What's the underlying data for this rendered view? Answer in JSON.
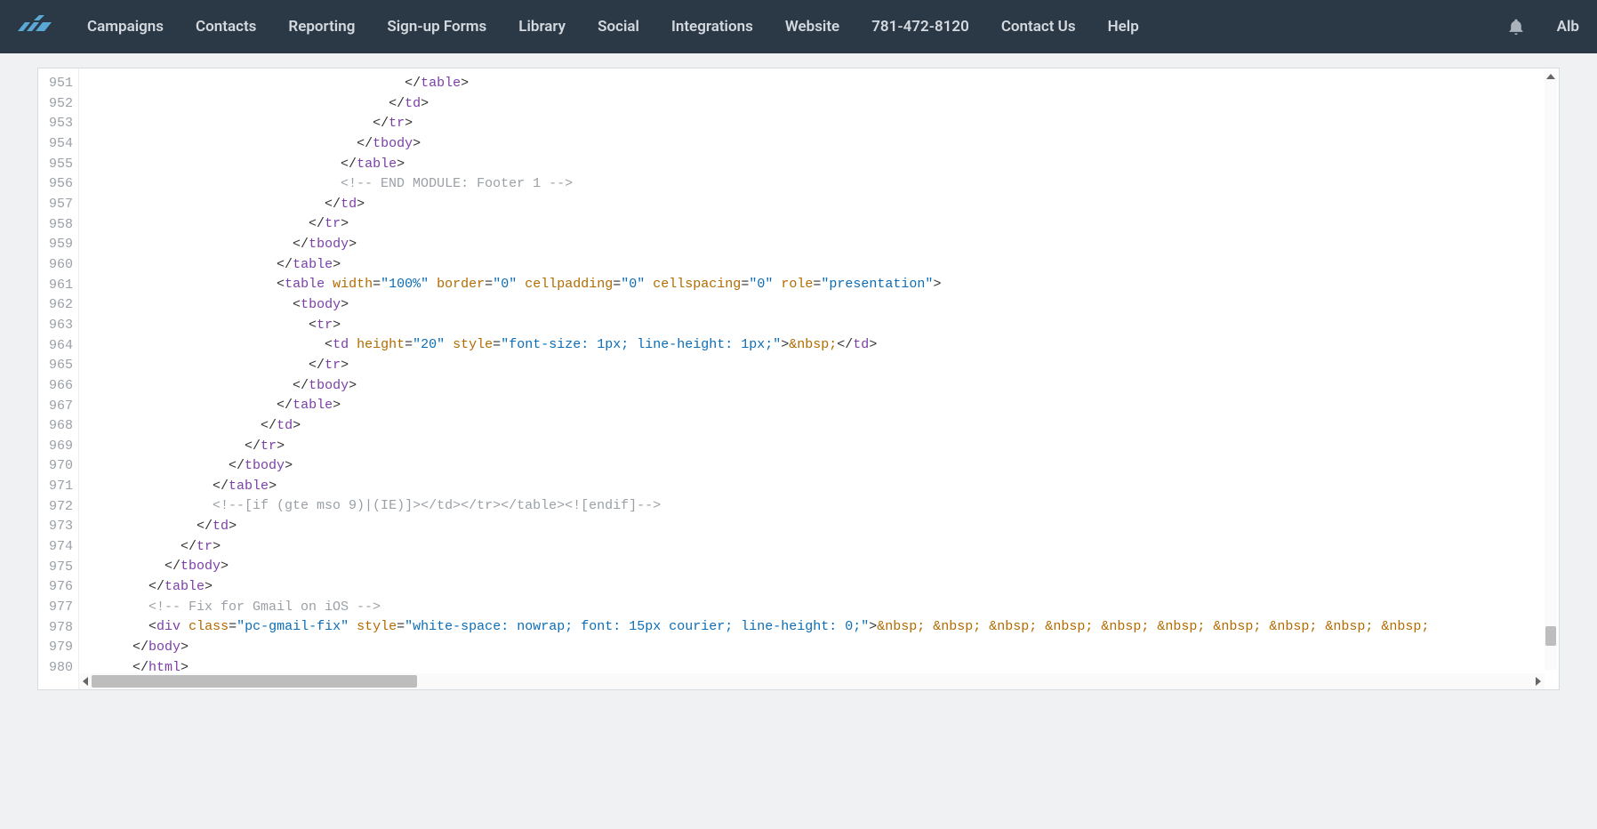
{
  "nav": {
    "items": [
      "Campaigns",
      "Contacts",
      "Reporting",
      "Sign-up Forms",
      "Library",
      "Social",
      "Integrations",
      "Website"
    ],
    "phone": "781-472-8120",
    "contact": "Contact Us",
    "help": "Help",
    "user": "Alb"
  },
  "gutter": {
    "start": 951,
    "count": 30
  },
  "code": [
    {
      "indent": 40,
      "tokens": [
        {
          "t": "punct",
          "v": "</"
        },
        {
          "t": "tag",
          "v": "table"
        },
        {
          "t": "punct",
          "v": ">"
        }
      ]
    },
    {
      "indent": 38,
      "tokens": [
        {
          "t": "punct",
          "v": "</"
        },
        {
          "t": "tag",
          "v": "td"
        },
        {
          "t": "punct",
          "v": ">"
        }
      ]
    },
    {
      "indent": 36,
      "tokens": [
        {
          "t": "punct",
          "v": "</"
        },
        {
          "t": "tag",
          "v": "tr"
        },
        {
          "t": "punct",
          "v": ">"
        }
      ]
    },
    {
      "indent": 34,
      "tokens": [
        {
          "t": "punct",
          "v": "</"
        },
        {
          "t": "tag",
          "v": "tbody"
        },
        {
          "t": "punct",
          "v": ">"
        }
      ]
    },
    {
      "indent": 32,
      "tokens": [
        {
          "t": "punct",
          "v": "</"
        },
        {
          "t": "tag",
          "v": "table"
        },
        {
          "t": "punct",
          "v": ">"
        }
      ]
    },
    {
      "indent": 32,
      "tokens": [
        {
          "t": "cmt",
          "v": "<!-- END MODULE: Footer 1 -->"
        }
      ]
    },
    {
      "indent": 30,
      "tokens": [
        {
          "t": "punct",
          "v": "</"
        },
        {
          "t": "tag",
          "v": "td"
        },
        {
          "t": "punct",
          "v": ">"
        }
      ]
    },
    {
      "indent": 28,
      "tokens": [
        {
          "t": "punct",
          "v": "</"
        },
        {
          "t": "tag",
          "v": "tr"
        },
        {
          "t": "punct",
          "v": ">"
        }
      ]
    },
    {
      "indent": 26,
      "tokens": [
        {
          "t": "punct",
          "v": "</"
        },
        {
          "t": "tag",
          "v": "tbody"
        },
        {
          "t": "punct",
          "v": ">"
        }
      ]
    },
    {
      "indent": 24,
      "tokens": [
        {
          "t": "punct",
          "v": "</"
        },
        {
          "t": "tag",
          "v": "table"
        },
        {
          "t": "punct",
          "v": ">"
        }
      ]
    },
    {
      "indent": 24,
      "tokens": [
        {
          "t": "punct",
          "v": "<"
        },
        {
          "t": "tag",
          "v": "table"
        },
        {
          "t": "punct",
          "v": " "
        },
        {
          "t": "attr",
          "v": "width"
        },
        {
          "t": "punct",
          "v": "="
        },
        {
          "t": "str",
          "v": "\"100%\""
        },
        {
          "t": "punct",
          "v": " "
        },
        {
          "t": "attr",
          "v": "border"
        },
        {
          "t": "punct",
          "v": "="
        },
        {
          "t": "str",
          "v": "\"0\""
        },
        {
          "t": "punct",
          "v": " "
        },
        {
          "t": "attr",
          "v": "cellpadding"
        },
        {
          "t": "punct",
          "v": "="
        },
        {
          "t": "str",
          "v": "\"0\""
        },
        {
          "t": "punct",
          "v": " "
        },
        {
          "t": "attr",
          "v": "cellspacing"
        },
        {
          "t": "punct",
          "v": "="
        },
        {
          "t": "str",
          "v": "\"0\""
        },
        {
          "t": "punct",
          "v": " "
        },
        {
          "t": "attr",
          "v": "role"
        },
        {
          "t": "punct",
          "v": "="
        },
        {
          "t": "str",
          "v": "\"presentation\""
        },
        {
          "t": "punct",
          "v": ">"
        }
      ]
    },
    {
      "indent": 26,
      "tokens": [
        {
          "t": "punct",
          "v": "<"
        },
        {
          "t": "tag",
          "v": "tbody"
        },
        {
          "t": "punct",
          "v": ">"
        }
      ]
    },
    {
      "indent": 28,
      "tokens": [
        {
          "t": "punct",
          "v": "<"
        },
        {
          "t": "tag",
          "v": "tr"
        },
        {
          "t": "punct",
          "v": ">"
        }
      ]
    },
    {
      "indent": 30,
      "tokens": [
        {
          "t": "punct",
          "v": "<"
        },
        {
          "t": "tag",
          "v": "td"
        },
        {
          "t": "punct",
          "v": " "
        },
        {
          "t": "attr",
          "v": "height"
        },
        {
          "t": "punct",
          "v": "="
        },
        {
          "t": "str",
          "v": "\"20\""
        },
        {
          "t": "punct",
          "v": " "
        },
        {
          "t": "attr",
          "v": "style"
        },
        {
          "t": "punct",
          "v": "="
        },
        {
          "t": "str",
          "v": "\"font-size: 1px; line-height: 1px;\""
        },
        {
          "t": "punct",
          "v": ">"
        },
        {
          "t": "ent",
          "v": "&nbsp;"
        },
        {
          "t": "punct",
          "v": "</"
        },
        {
          "t": "tag",
          "v": "td"
        },
        {
          "t": "punct",
          "v": ">"
        }
      ]
    },
    {
      "indent": 28,
      "tokens": [
        {
          "t": "punct",
          "v": "</"
        },
        {
          "t": "tag",
          "v": "tr"
        },
        {
          "t": "punct",
          "v": ">"
        }
      ]
    },
    {
      "indent": 26,
      "tokens": [
        {
          "t": "punct",
          "v": "</"
        },
        {
          "t": "tag",
          "v": "tbody"
        },
        {
          "t": "punct",
          "v": ">"
        }
      ]
    },
    {
      "indent": 24,
      "tokens": [
        {
          "t": "punct",
          "v": "</"
        },
        {
          "t": "tag",
          "v": "table"
        },
        {
          "t": "punct",
          "v": ">"
        }
      ]
    },
    {
      "indent": 22,
      "tokens": [
        {
          "t": "punct",
          "v": "</"
        },
        {
          "t": "tag",
          "v": "td"
        },
        {
          "t": "punct",
          "v": ">"
        }
      ]
    },
    {
      "indent": 20,
      "tokens": [
        {
          "t": "punct",
          "v": "</"
        },
        {
          "t": "tag",
          "v": "tr"
        },
        {
          "t": "punct",
          "v": ">"
        }
      ]
    },
    {
      "indent": 18,
      "tokens": [
        {
          "t": "punct",
          "v": "</"
        },
        {
          "t": "tag",
          "v": "tbody"
        },
        {
          "t": "punct",
          "v": ">"
        }
      ]
    },
    {
      "indent": 16,
      "tokens": [
        {
          "t": "punct",
          "v": "</"
        },
        {
          "t": "tag",
          "v": "table"
        },
        {
          "t": "punct",
          "v": ">"
        }
      ]
    },
    {
      "indent": 16,
      "tokens": [
        {
          "t": "cmt",
          "v": "<!--[if (gte mso 9)|(IE)]></td></tr></table><![endif]-->"
        }
      ]
    },
    {
      "indent": 14,
      "tokens": [
        {
          "t": "punct",
          "v": "</"
        },
        {
          "t": "tag",
          "v": "td"
        },
        {
          "t": "punct",
          "v": ">"
        }
      ]
    },
    {
      "indent": 12,
      "tokens": [
        {
          "t": "punct",
          "v": "</"
        },
        {
          "t": "tag",
          "v": "tr"
        },
        {
          "t": "punct",
          "v": ">"
        }
      ]
    },
    {
      "indent": 10,
      "tokens": [
        {
          "t": "punct",
          "v": "</"
        },
        {
          "t": "tag",
          "v": "tbody"
        },
        {
          "t": "punct",
          "v": ">"
        }
      ]
    },
    {
      "indent": 8,
      "tokens": [
        {
          "t": "punct",
          "v": "</"
        },
        {
          "t": "tag",
          "v": "table"
        },
        {
          "t": "punct",
          "v": ">"
        }
      ]
    },
    {
      "indent": 8,
      "tokens": [
        {
          "t": "cmt",
          "v": "<!-- Fix for Gmail on iOS -->"
        }
      ]
    },
    {
      "indent": 8,
      "tokens": [
        {
          "t": "punct",
          "v": "<"
        },
        {
          "t": "tag",
          "v": "div"
        },
        {
          "t": "punct",
          "v": " "
        },
        {
          "t": "attr",
          "v": "class"
        },
        {
          "t": "punct",
          "v": "="
        },
        {
          "t": "str",
          "v": "\"pc-gmail-fix\""
        },
        {
          "t": "punct",
          "v": " "
        },
        {
          "t": "attr",
          "v": "style"
        },
        {
          "t": "punct",
          "v": "="
        },
        {
          "t": "str",
          "v": "\"white-space: nowrap; font: 15px courier; line-height: 0;\""
        },
        {
          "t": "punct",
          "v": ">"
        },
        {
          "t": "ent",
          "v": "&nbsp; &nbsp; &nbsp; &nbsp; &nbsp; &nbsp; &nbsp; &nbsp; &nbsp; &nbsp;"
        }
      ]
    },
    {
      "indent": 6,
      "tokens": [
        {
          "t": "punct",
          "v": "</"
        },
        {
          "t": "tag",
          "v": "body"
        },
        {
          "t": "punct",
          "v": ">"
        }
      ]
    },
    {
      "indent": 6,
      "tokens": [
        {
          "t": "punct",
          "v": "</"
        },
        {
          "t": "tag",
          "v": "html"
        },
        {
          "t": "punct",
          "v": ">"
        }
      ]
    }
  ]
}
